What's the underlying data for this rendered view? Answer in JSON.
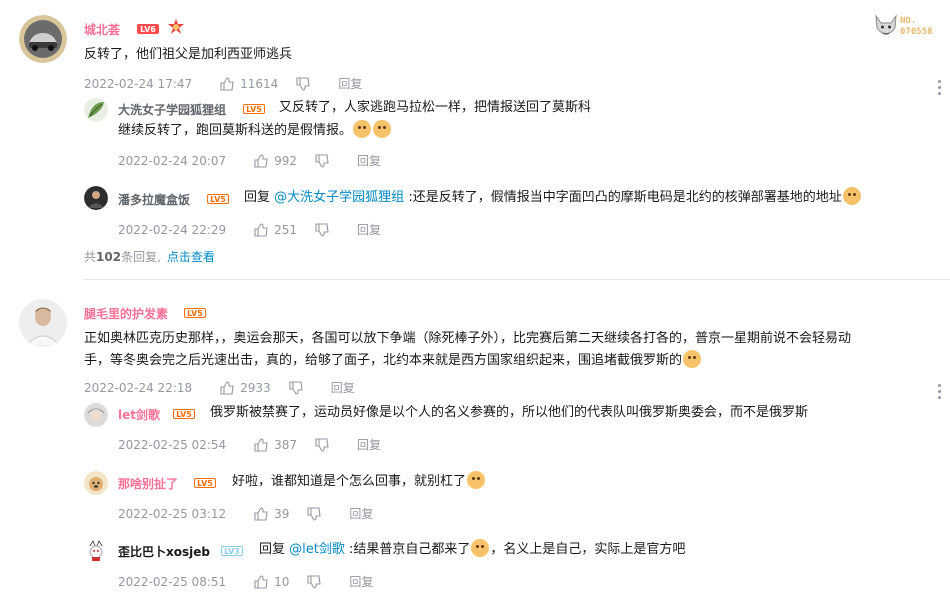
{
  "badge": {
    "label": "NO.",
    "number": "070558"
  },
  "c1": {
    "user": "城北荟",
    "level": "LV6",
    "text": "反转了，他们祖父是加利西亚师逃兵",
    "time": "2022-02-24 17:47",
    "likes": "11614",
    "reply": "回复",
    "r1": {
      "user": "大洗女子学园狐狸组",
      "level": "LV5",
      "line1": "又反转了，人家逃跑马拉松一样，把情报送回了莫斯科",
      "line2": "继续反转了，跑回莫斯科送的是假情报。",
      "time": "2022-02-24 20:07",
      "likes": "992",
      "reply": "回复"
    },
    "r2": {
      "user": "潘多拉魔盒饭",
      "level": "LV5",
      "prefix": "回复",
      "at": "@大洗女子学园狐狸组",
      "text": ":还是反转了，假情报当中字面凹凸的摩斯电码是北约的核弹部署基地的地址",
      "time": "2022-02-24 22:29",
      "likes": "251",
      "reply": "回复"
    },
    "total_prefix": "共",
    "total": "102",
    "total_suffix": "条回复,",
    "view": "点击查看"
  },
  "c2": {
    "user": "腿毛里的护发素",
    "level": "LV5",
    "line1": "正如奥林匹克历史那样，，奥运会那天，各国可以放下争端（除死棒子外），比完赛后第二天继续各打各的，普京一星期前说不会轻易动",
    "line2": "手，等冬奥会完之后光速出击，真的，给够了面子，北约本来就是西方国家组织起来，围追堵截俄罗斯的",
    "time": "2022-02-24 22:18",
    "likes": "2933",
    "reply": "回复",
    "r1": {
      "user": "let剑歌",
      "level": "LV5",
      "text": "俄罗斯被禁赛了，运动员好像是以个人的名义参赛的，所以他们的代表队叫俄罗斯奥委会，而不是俄罗斯",
      "time": "2022-02-25 02:54",
      "likes": "387",
      "reply": "回复"
    },
    "r2": {
      "user": "那啥别扯了",
      "level": "LV5",
      "text": "好啦，谁都知道是个怎么回事，就别杠了",
      "time": "2022-02-25 03:12",
      "likes": "39",
      "reply": "回复"
    },
    "r3": {
      "user": "歪比巴卜xosjeb",
      "level": "LV3",
      "prefix": "回复",
      "at": "@let剑歌",
      "text1": ":结果普京自己都来了",
      "text2": "，名义上是自己，实际上是官方吧",
      "time": "2022-02-25 08:51",
      "likes": "10",
      "reply": "回复"
    }
  }
}
